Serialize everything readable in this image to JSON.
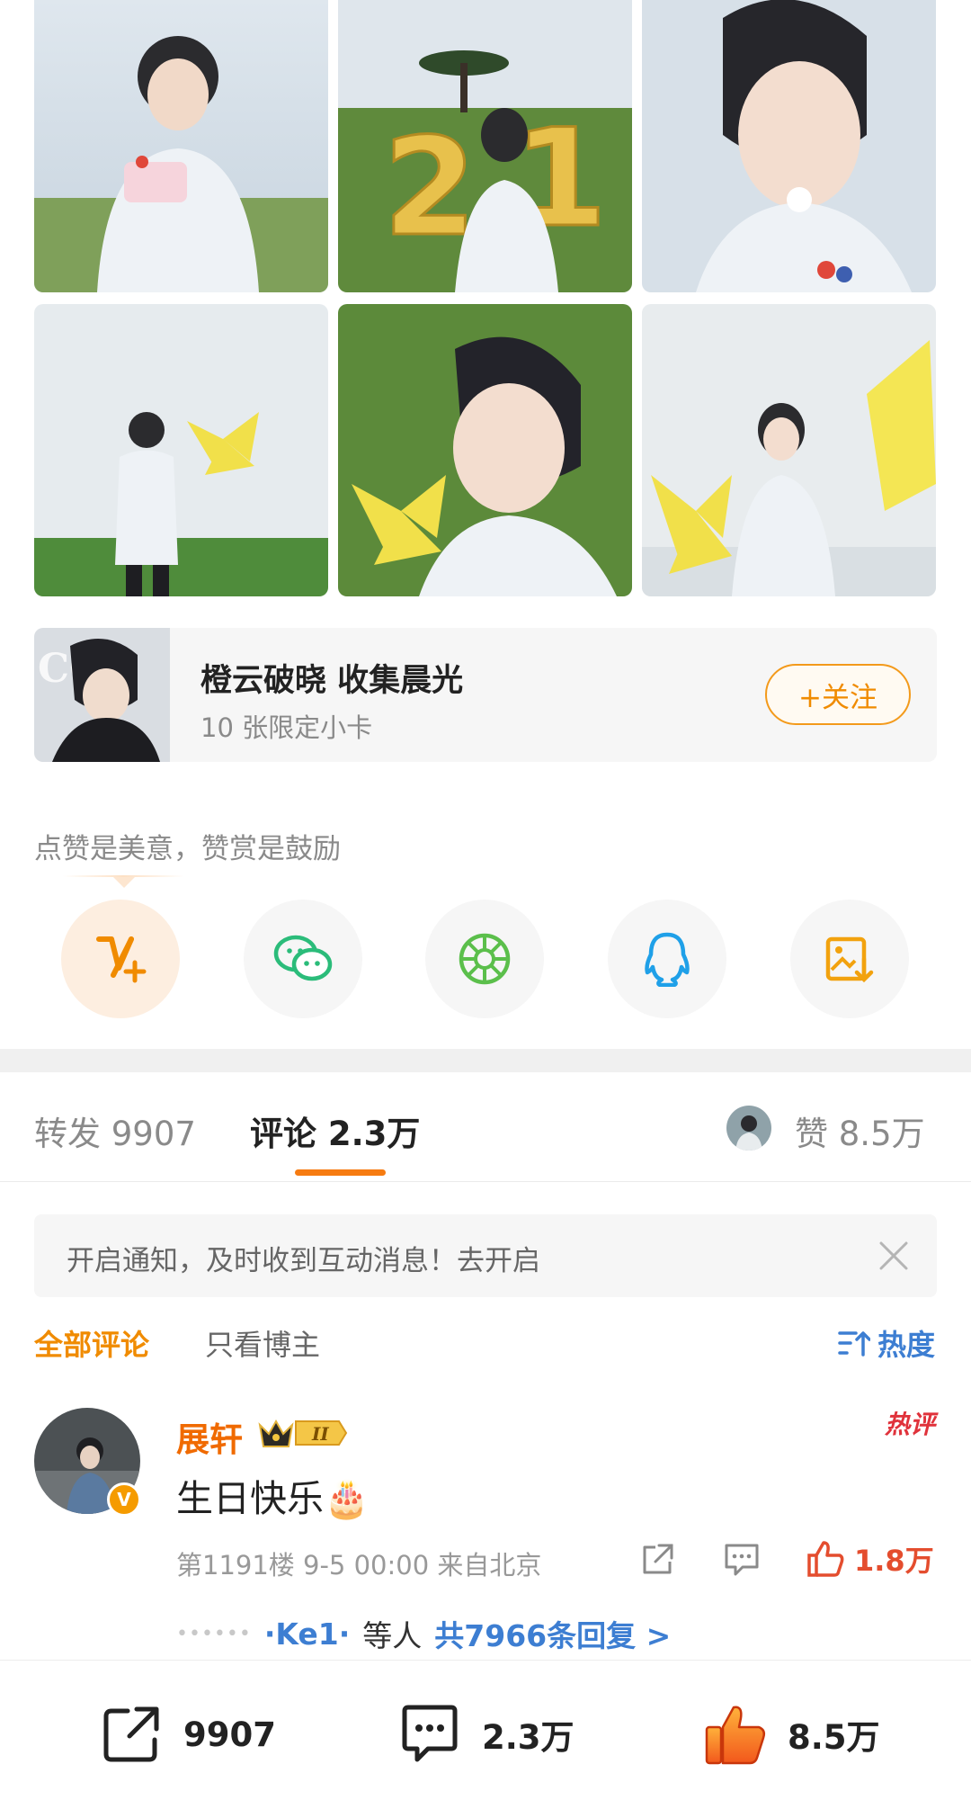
{
  "photos": [
    {
      "alt": "photo-1"
    },
    {
      "alt": "photo-2"
    },
    {
      "alt": "photo-3"
    },
    {
      "alt": "photo-4"
    },
    {
      "alt": "photo-5"
    },
    {
      "alt": "photo-6"
    }
  ],
  "card": {
    "title": "橙云破晓 收集晨光",
    "subtitle": "10 张限定小卡",
    "follow_label": "+关注"
  },
  "encourage_text": "点赞是美意，赞赏是鼓励",
  "share_icons": [
    "v-plus-icon",
    "wechat-icon",
    "moments-icon",
    "qq-icon",
    "save-image-icon"
  ],
  "tabs": {
    "repost": "转发 9907",
    "comment": "评论 2.3万",
    "like": "赞 8.5万"
  },
  "notice": {
    "text": "开启通知，及时收到互动消息！去开启"
  },
  "filters": {
    "all": "全部评论",
    "author_only": "只看博主",
    "sort": "热度"
  },
  "comment": {
    "username": "展轩",
    "level_badge": "II",
    "hot_tag": "热评",
    "text": "生日快乐🎂",
    "meta": "第1191楼 9-5 00:00 来自北京",
    "likes": "1.8万",
    "thread_user": "·Ke1·",
    "thread_mid": "等人",
    "thread_count": "共7966条回复 >"
  },
  "bottom_bar": {
    "repost": "9907",
    "comment": "2.3万",
    "like": "8.5万"
  },
  "colors": {
    "accent_orange": "#f08b00",
    "link_blue": "#3d7ed2",
    "like_red": "#e44d2e"
  }
}
